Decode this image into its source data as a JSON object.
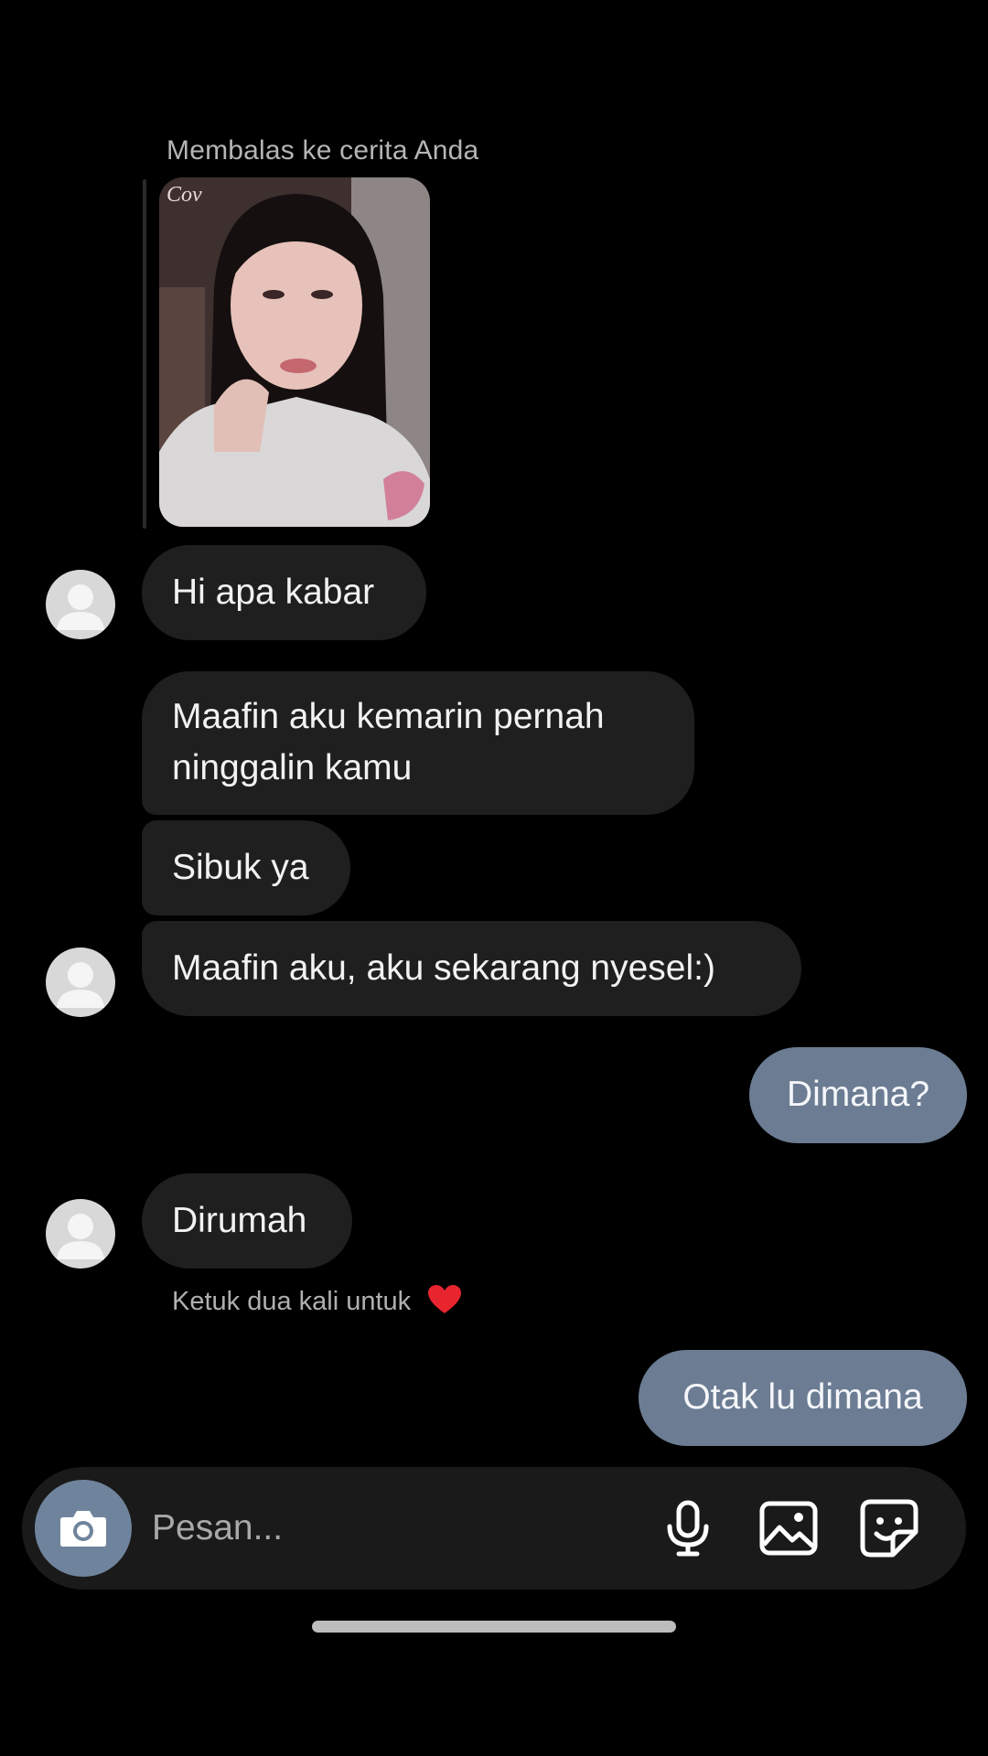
{
  "thread": {
    "reply_context": "Membalas ke cerita Anda",
    "story_thumbnail_overlay": "Cov"
  },
  "messages": [
    {
      "direction": "incoming",
      "text": "Hi apa kabar"
    },
    {
      "direction": "incoming",
      "text": "Maafin aku kemarin pernah\nninggalin kamu"
    },
    {
      "direction": "incoming",
      "text": "Sibuk ya"
    },
    {
      "direction": "incoming",
      "text": "Maafin aku, aku sekarang nyesel:)"
    },
    {
      "direction": "outgoing",
      "text": "Dimana?"
    },
    {
      "direction": "incoming",
      "text": "Dirumah"
    },
    {
      "direction": "outgoing",
      "text": "Otak lu dimana"
    }
  ],
  "reaction_hint": "Ketuk dua kali untuk",
  "reaction_icon": "heart-icon",
  "composer": {
    "placeholder": "Pesan...",
    "icons": [
      "camera-icon",
      "microphone-icon",
      "gallery-icon",
      "sticker-icon"
    ]
  },
  "colors": {
    "background": "#000000",
    "incoming_bubble": "#1f1f1f",
    "outgoing_bubble": "#6b7c93",
    "heart": "#e8252f"
  }
}
